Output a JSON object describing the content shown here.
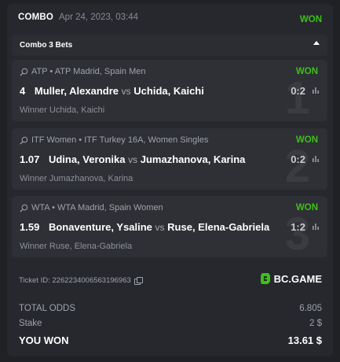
{
  "header": {
    "title": "COMBO",
    "date": "Apr 24, 2023, 03:44",
    "status": "WON"
  },
  "combo": {
    "label": "Combo 3 Bets"
  },
  "bets": [
    {
      "number": "1",
      "league": "ATP • ATP Madrid, Spain Men",
      "status": "WON",
      "odds": "4",
      "player1": "Muller, Alexandre",
      "vs": "vs",
      "player2": "Uchida, Kaichi",
      "score": "0:2",
      "winner": "Winner Uchida, Kaichi"
    },
    {
      "number": "2",
      "league": "ITF Women • ITF Turkey 16A, Women Singles",
      "status": "WON",
      "odds": "1.07",
      "player1": "Udina, Veronika",
      "vs": "vs",
      "player2": "Jumazhanova, Karina",
      "score": "0:2",
      "winner": "Winner Jumazhanova, Karina"
    },
    {
      "number": "3",
      "league": "WTA • WTA Madrid, Spain Women",
      "status": "WON",
      "odds": "1.59",
      "player1": "Bonaventure, Ysaline",
      "vs": "vs",
      "player2": "Ruse, Elena-Gabriela",
      "score": "1:2",
      "winner": "Winner Ruse, Elena-Gabriela"
    }
  ],
  "ticket": {
    "label": "Ticket ID: 2262234006563196963"
  },
  "brand": {
    "name": "BC.GAME"
  },
  "summary": {
    "total_odds_label": "TOTAL ODDS",
    "total_odds_value": "6.805",
    "stake_label": "Stake",
    "stake_value": "2 $",
    "won_label": "YOU WON",
    "won_value": "13.61 $"
  },
  "colors": {
    "won": "#3bc117",
    "background": "#1f2125",
    "card": "#26282d",
    "bet_card": "#2e3035"
  },
  "icons": {
    "sport": "tennis-racket-icon",
    "stats": "bar-chart-icon",
    "copy": "copy-icon",
    "brand": "bc-game-logo-icon"
  }
}
